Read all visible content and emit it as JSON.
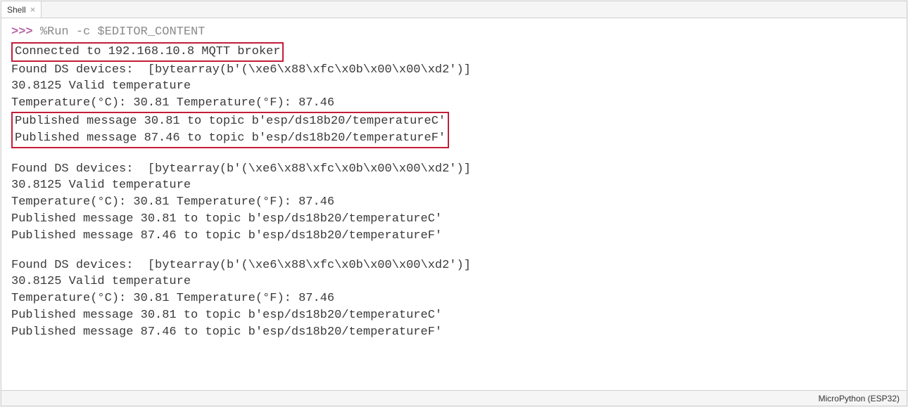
{
  "tab": {
    "label": "Shell"
  },
  "prompt": {
    "chevrons": ">>>",
    "command": "%Run -c $EDITOR_CONTENT"
  },
  "output": {
    "connected": "Connected to 192.168.10.8 MQTT broker",
    "block1": {
      "found": "Found DS devices:  [bytearray(b'(\\xe6\\x88\\xfc\\x0b\\x00\\x00\\xd2')]",
      "valid": "30.8125 Valid temperature",
      "temps": "Temperature(°C): 30.81 Temperature(°F): 87.46",
      "pub1": "Published message 30.81 to topic b'esp/ds18b20/temperatureC'",
      "pub2": "Published message 87.46 to topic b'esp/ds18b20/temperatureF'"
    },
    "block2": {
      "found": "Found DS devices:  [bytearray(b'(\\xe6\\x88\\xfc\\x0b\\x00\\x00\\xd2')]",
      "valid": "30.8125 Valid temperature",
      "temps": "Temperature(°C): 30.81 Temperature(°F): 87.46",
      "pub1": "Published message 30.81 to topic b'esp/ds18b20/temperatureC'",
      "pub2": "Published message 87.46 to topic b'esp/ds18b20/temperatureF'"
    },
    "block3": {
      "found": "Found DS devices:  [bytearray(b'(\\xe6\\x88\\xfc\\x0b\\x00\\x00\\xd2')]",
      "valid": "30.8125 Valid temperature",
      "temps": "Temperature(°C): 30.81 Temperature(°F): 87.46",
      "pub1": "Published message 30.81 to topic b'esp/ds18b20/temperatureC'",
      "pub2": "Published message 87.46 to topic b'esp/ds18b20/temperatureF'"
    }
  },
  "statusbar": {
    "interpreter": "MicroPython (ESP32)"
  }
}
